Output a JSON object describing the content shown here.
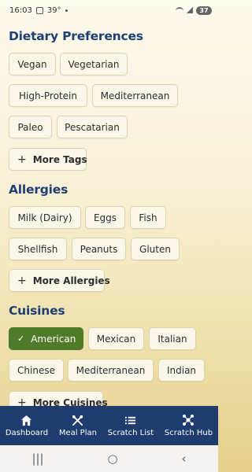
{
  "status_bar": {
    "time": "16:03",
    "temp": "39°",
    "battery": "37"
  },
  "sections": {
    "dietary": {
      "title": "Dietary Preferences",
      "tags": [
        "Vegan",
        "Vegetarian",
        "High-Protein",
        "Mediterranean",
        "Paleo",
        "Pescatarian"
      ],
      "more_label": "More Tags"
    },
    "allergies": {
      "title": "Allergies",
      "tags": [
        "Milk (Dairy)",
        "Eggs",
        "Fish",
        "Shellfish",
        "Peanuts",
        "Gluten"
      ],
      "more_label": "More Allergies"
    },
    "cuisines": {
      "title": "Cuisines",
      "tags": [
        "American",
        "Mexican",
        "Italian",
        "Chinese",
        "Mediterranean",
        "Indian"
      ],
      "selected": [
        "American"
      ],
      "more_label": "More Cuisines"
    }
  },
  "bottom_nav": {
    "items": [
      {
        "label": "Dashboard",
        "icon": "home-icon"
      },
      {
        "label": "Meal Plan",
        "icon": "utensils-icon"
      },
      {
        "label": "Scratch List",
        "icon": "list-icon"
      },
      {
        "label": "Scratch Hub",
        "icon": "hub-icon"
      }
    ]
  },
  "colors": {
    "title": "#1f3f73",
    "selected_chip": "#4f7a2a",
    "nav_bg": "#1e3c6e"
  }
}
